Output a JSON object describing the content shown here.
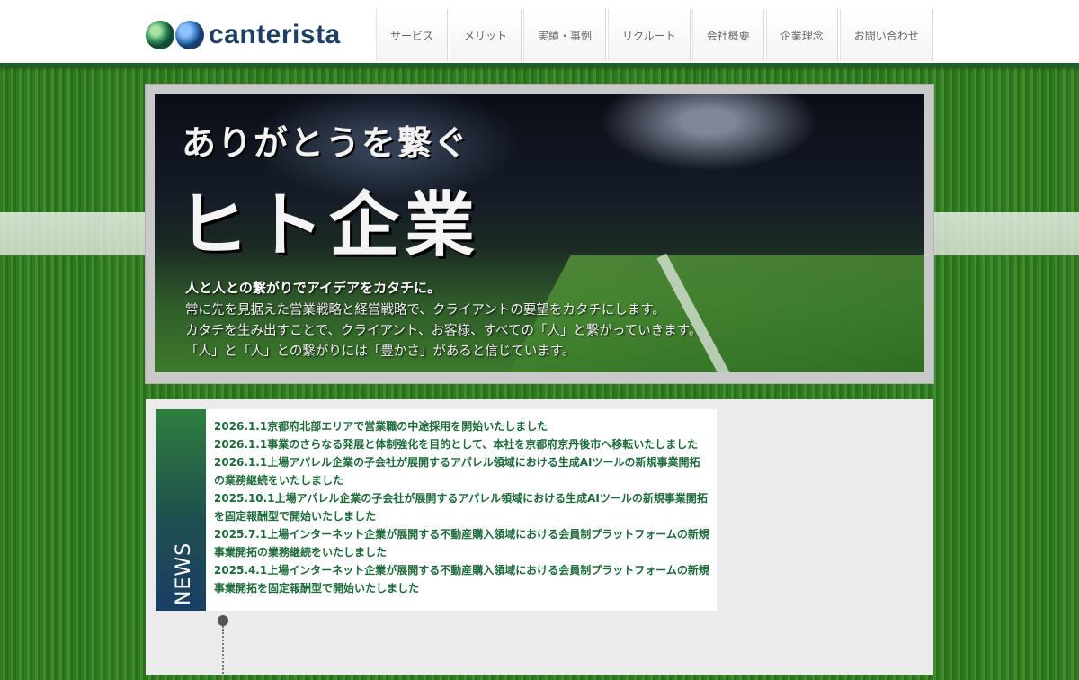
{
  "brand": {
    "name": "canterista",
    "colors": {
      "header_border": "#1d5e2c",
      "news_text": "#1d6b3a"
    }
  },
  "nav": {
    "items": [
      "サービス",
      "メリット",
      "実績・事例",
      "リクルート",
      "会社概要",
      "企業理念",
      "お問い合わせ"
    ]
  },
  "hero": {
    "title1": "ありがとうを繋ぐ",
    "title2": "ヒト企業",
    "lead": "人と人との繋がりでアイデアをカタチに。",
    "body": [
      "常に先を見据えた営業戦略と経営戦略で、クライアントの要望をカタチにします。",
      "カタチを生み出すことで、クライアント、お客様、すべての「人」と繋がっていきます。",
      "「人」と「人」との繋がりには「豊かさ」があると信じています。"
    ]
  },
  "news": {
    "label": "NEWS",
    "items": [
      "2026.1.1京都府北部エリアで営業職の中途採用を開始いたしました",
      "2026.1.1事業のさらなる発展と体制強化を目的として、本社を京都府京丹後市へ移転いたしました",
      "2026.1.1上場アパレル企業の子会社が展開するアパレル領域における生成AIツールの新規事業開拓の業務継続をいたしました",
      "2025.10.1上場アパレル企業の子会社が展開するアパレル領域における生成AIツールの新規事業開拓を固定報酬型で開始いたしました",
      "2025.7.1上場インターネット企業が展開する不動産購入領域における会員制プラットフォームの新規事業開拓の業務継続をいたしました",
      "2025.4.1上場インターネット企業が展開する不動産購入領域における会員制プラットフォームの新規事業開拓を固定報酬型で開始いたしました"
    ]
  }
}
